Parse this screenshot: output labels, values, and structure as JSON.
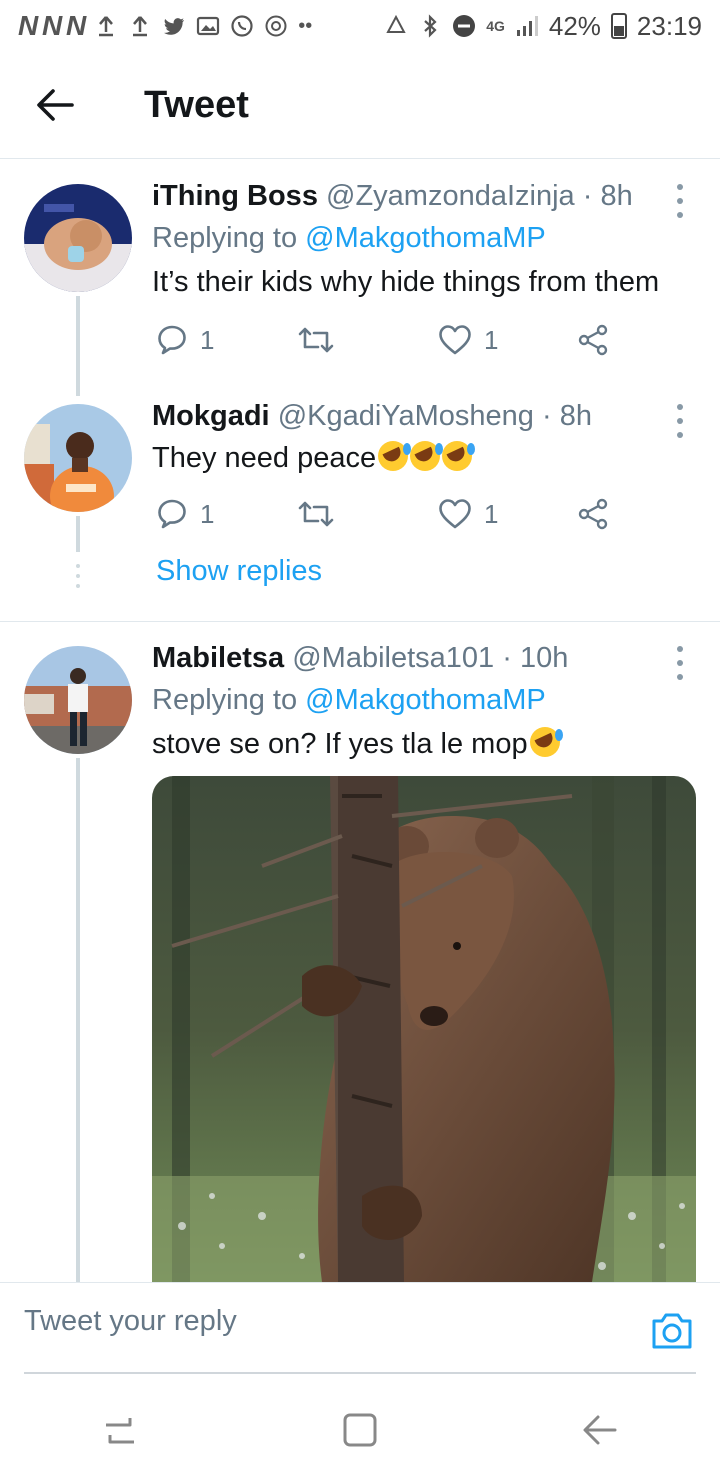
{
  "status_bar": {
    "left_letters": "N N N",
    "network": "4G",
    "battery": "42%",
    "time": "23:19"
  },
  "header": {
    "title": "Tweet"
  },
  "tweets": [
    {
      "name": "iThing Boss",
      "handle": "@ZyamzondaIzinja",
      "time": "· 8h",
      "replying_prefix": "Replying to ",
      "replying_to": "@MakgothomaMP",
      "text": "It’s their kids why hide things from them",
      "reply_count": "1",
      "like_count": "1"
    },
    {
      "name": "Mokgadi",
      "handle": "@KgadiYaMosheng",
      "time": "· 8h",
      "text": "They need peace",
      "reply_count": "1",
      "like_count": "1"
    },
    {
      "name": "Mabiletsa",
      "handle": "@Mabiletsa101",
      "time": "· 10h",
      "replying_prefix": "Replying to ",
      "replying_to": "@MakgothomaMP",
      "text": "stove se on? If yes tla le mop"
    }
  ],
  "show_replies": "Show replies",
  "reply_bar": {
    "placeholder": "Tweet your reply"
  },
  "colors": {
    "accent": "#1da1f2",
    "text": "#14171a",
    "secondary": "#657786",
    "thread_line": "#cfd9de"
  }
}
